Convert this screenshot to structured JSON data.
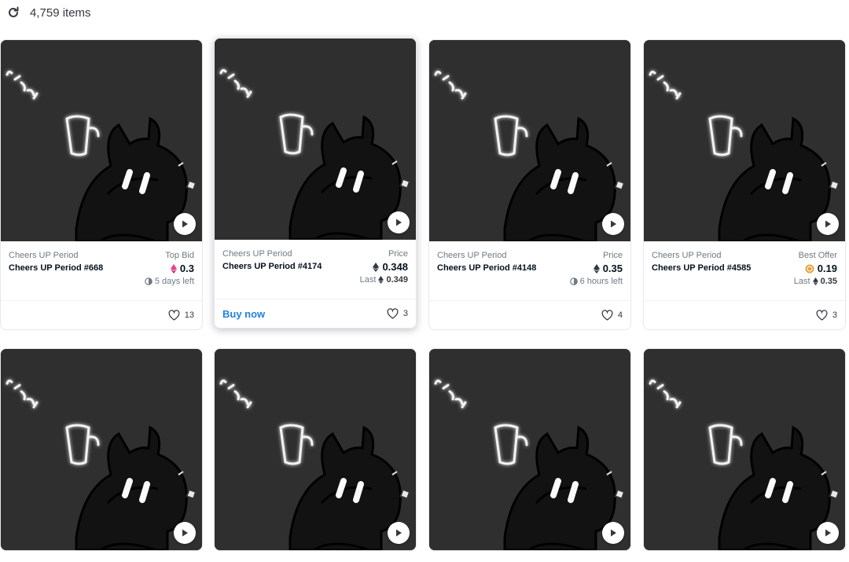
{
  "header": {
    "refresh_icon": "refresh-icon",
    "items_count": "4,759 items"
  },
  "colors": {
    "accent": "#2081e2",
    "eth": "#353840",
    "weth": "#ec3f8f",
    "ape": "#e5a33b"
  },
  "cards": [
    {
      "collection": "Cheers UP Period",
      "name": "Cheers UP Period #668",
      "price_label": "Top Bid",
      "currency_icon": "weth-icon",
      "price": "0.3",
      "sub_icon": "clock-icon",
      "sub_text": "5 days left",
      "likes": "13",
      "buy_label": ""
    },
    {
      "collection": "Cheers UP Period",
      "name": "Cheers UP Period #4174",
      "price_label": "Price",
      "currency_icon": "eth-icon",
      "price": "0.348",
      "sub_prefix": "Last",
      "sub_icon": "eth-icon",
      "sub_text": "0.349",
      "likes": "3",
      "buy_label": "Buy now"
    },
    {
      "collection": "Cheers UP Period",
      "name": "Cheers UP Period #4148",
      "price_label": "Price",
      "currency_icon": "eth-icon",
      "price": "0.35",
      "sub_icon": "clock-icon",
      "sub_text": "6 hours left",
      "likes": "4",
      "buy_label": ""
    },
    {
      "collection": "Cheers UP Period",
      "name": "Cheers UP Period #4585",
      "price_label": "Best Offer",
      "currency_icon": "ape-coin-icon",
      "price": "0.19",
      "sub_prefix": "Last",
      "sub_icon": "eth-icon",
      "sub_text": "0.35",
      "likes": "3",
      "buy_label": ""
    }
  ]
}
